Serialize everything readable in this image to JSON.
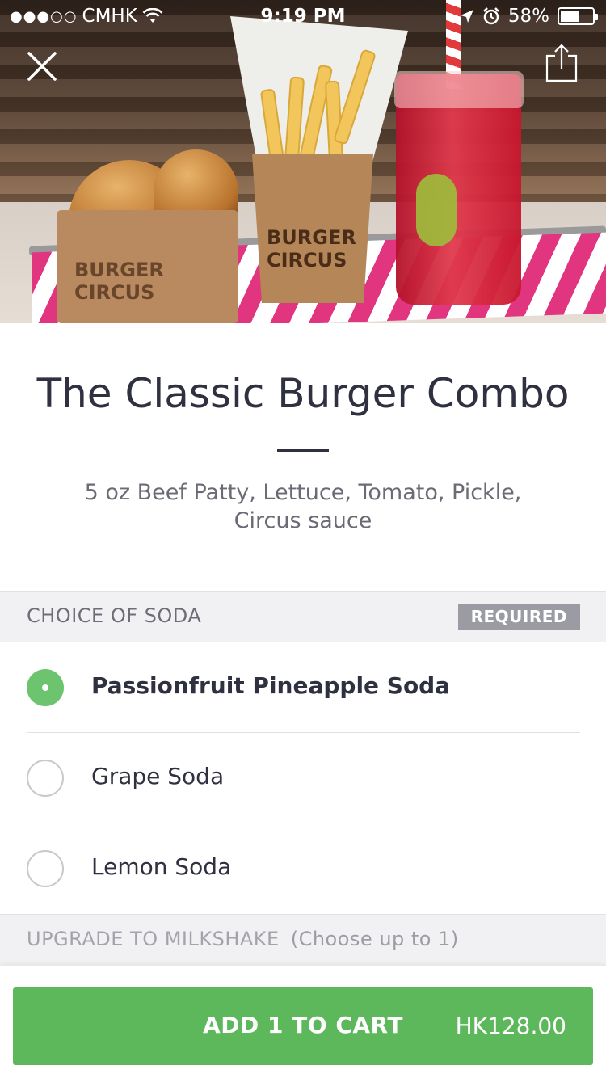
{
  "status_bar": {
    "carrier": "CMHK",
    "signal_dots": "●●●○○",
    "time": "9:19 PM",
    "battery_percent": "58%",
    "battery_level": 0.58
  },
  "hero": {
    "box_brand": "BURGER\nCIRCUS",
    "cup_brand": "BURGER\nCIRCUS"
  },
  "item": {
    "title": "The Classic Burger Combo",
    "description": "5 oz Beef Patty, Lettuce, Tomato, Pickle, Circus sauce"
  },
  "soda_section": {
    "label": "CHOICE OF SODA",
    "badge": "REQUIRED",
    "options": [
      {
        "label": "Passionfruit Pineapple Soda",
        "selected": true
      },
      {
        "label": "Grape Soda",
        "selected": false
      },
      {
        "label": "Lemon Soda",
        "selected": false
      }
    ]
  },
  "milkshake_section": {
    "label": "UPGRADE TO MILKSHAKE",
    "hint": "(Choose up to 1)"
  },
  "cart": {
    "cta": "ADD 1 TO CART",
    "price": "HK128.00"
  },
  "colors": {
    "accent_green": "#5db85c",
    "radio_green": "#6cc56e",
    "badge_gray": "#9b9ba3"
  },
  "icons": {
    "close": "close-icon",
    "share": "share-icon",
    "wifi": "wifi-icon",
    "location": "location-arrow-icon",
    "alarm": "alarm-icon",
    "battery": "battery-icon"
  }
}
